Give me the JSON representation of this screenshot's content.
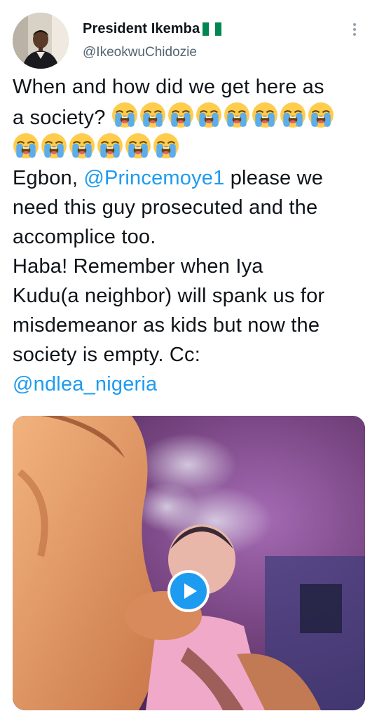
{
  "author": {
    "display_name": "President Ikemba",
    "flag_icon": "nigeria-flag-icon",
    "handle": "@IkeokwuChidozie",
    "avatar_icon": "profile-avatar"
  },
  "menu": {
    "icon": "more-vertical-icon"
  },
  "tweet": {
    "line1": "When and how did we get here as",
    "line2_text": "a society?",
    "emoji_icon": "loudly-crying-face-icon",
    "emoji_first_line_count": 8,
    "emoji_second_line_count": 6,
    "line4_prefix": "Egbon, ",
    "mention1": "@Princemoye1",
    "line4_suffix": " please we",
    "line5": "need this guy prosecuted and the",
    "line6": "accomplice too.",
    "line7": "Haba! Remember when Iya",
    "line8": "Kudu(a neighbor) will spank us for",
    "line9": "misdemeanor as kids but now the",
    "line10": "society is empty. Cc:",
    "mention2": "@ndlea_nigeria"
  },
  "media": {
    "type": "video",
    "play_icon": "play-icon"
  },
  "colors": {
    "link": "#1d9bf0",
    "text": "#0f1419",
    "secondary": "#536471",
    "flag_green": "#008751"
  }
}
